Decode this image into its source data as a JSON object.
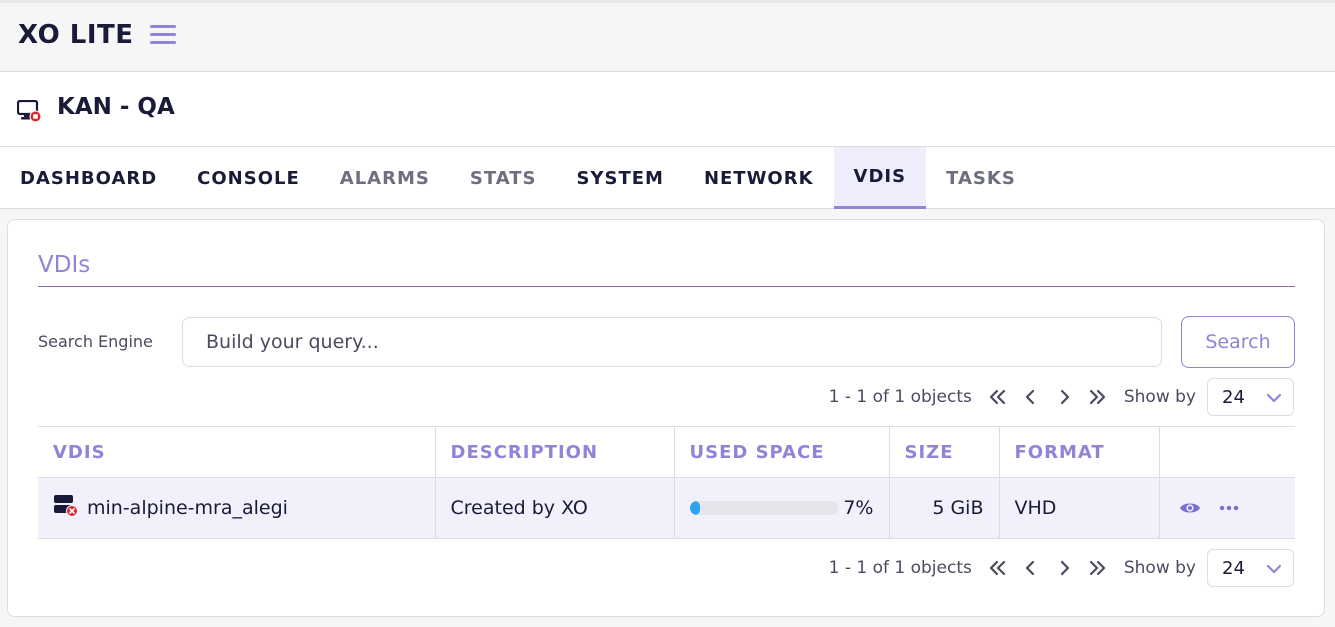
{
  "app": {
    "logo": "XO LITE"
  },
  "vm": {
    "name": "KAN - QA",
    "icon": "vm-halted-icon"
  },
  "tabs": [
    {
      "label": "DASHBOARD",
      "state": "dark"
    },
    {
      "label": "CONSOLE",
      "state": "dark"
    },
    {
      "label": "ALARMS",
      "state": "muted"
    },
    {
      "label": "STATS",
      "state": "muted"
    },
    {
      "label": "SYSTEM",
      "state": "dark"
    },
    {
      "label": "NETWORK",
      "state": "dark"
    },
    {
      "label": "VDIS",
      "state": "active"
    },
    {
      "label": "TASKS",
      "state": "muted"
    }
  ],
  "card": {
    "title": "VDIs",
    "search": {
      "label": "Search Engine",
      "placeholder": "Build your query...",
      "button": "Search"
    },
    "pagination": {
      "count": "1 - 1 of 1 objects",
      "show_by_label": "Show by",
      "show_by_value": "24"
    },
    "table": {
      "columns": [
        "VDIS",
        "DESCRIPTION",
        "USED SPACE",
        "SIZE",
        "FORMAT",
        ""
      ],
      "rows": [
        {
          "name": "min-alpine-mra_alegi",
          "description": "Created by XO",
          "used_percent": 7,
          "used_label": "7%",
          "size": "5 GiB",
          "format": "VHD"
        }
      ]
    }
  },
  "colors": {
    "accent": "#8f84d8",
    "bar_fill": "#2ba3f0",
    "halted_badge": "#d9282f"
  }
}
